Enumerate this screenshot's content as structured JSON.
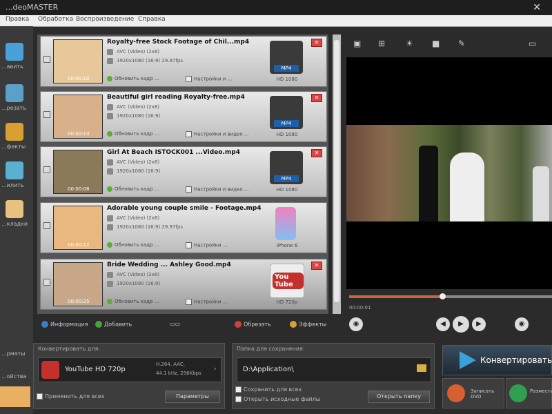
{
  "app": {
    "title": "...deoMASTER"
  },
  "menu": [
    "Правка",
    "Обработка",
    "Воспроизведение",
    "Справка"
  ],
  "sidebar": {
    "items": [
      {
        "label": "...авить",
        "icon": "add-video-icon",
        "color": "#4aa0d8"
      },
      {
        "label": "...резать",
        "icon": "cut-icon",
        "color": "#5aa0c8"
      },
      {
        "label": "...фекты",
        "icon": "effects-icon",
        "color": "#d8a030"
      },
      {
        "label": "...илить",
        "icon": "enhance-icon",
        "color": "#5ab0d0"
      },
      {
        "label": "...кладки",
        "icon": "tab-icon",
        "color": "#e8c080"
      }
    ],
    "bottom": [
      "...рматы",
      "...ойства"
    ]
  },
  "files": [
    {
      "name": "Royalty-free Stock Footage of Chil...mp4",
      "info1": "AVC (Video) (2x8)",
      "info2": "1920x1080 (16:9) 29.97fps",
      "opt1": "Обновить кадр ...",
      "opt2": "Настройки и ...",
      "duration": "00:00:10",
      "format_badge": "MP4",
      "format_caption": "HD 1080",
      "thumb_color": "#e8c89a"
    },
    {
      "name": "Beautiful girl reading Royalty-free.mp4",
      "info1": "AVC (Video) (2x8)",
      "info2": "1920x1080 (16:9)",
      "opt1": "Обновить кадр ...",
      "opt2": "Настройки и видео ...",
      "duration": "00:00:13",
      "format_badge": "MP4",
      "format_caption": "HD 1080",
      "thumb_color": "#d8b08a"
    },
    {
      "name": "Girl At Beach ISTOCK001 ...Video.mp4",
      "info1": "AVC (Video) (2x8)",
      "info2": "1920x1080 (16:9)",
      "opt1": "Обновить кадр ...",
      "opt2": "Настройки и видео ...",
      "duration": "00:00:08",
      "format_badge": "MP4",
      "format_caption": "HD 1080",
      "thumb_color": "#8a7a5a"
    },
    {
      "name": "Adorable young couple smile - Footage.mp4",
      "info1": "AVC (Video) (2x8)",
      "info2": "1920x1080 (16:9) 29.97fps",
      "opt1": "Обновить кадр ...",
      "opt2": "Настройки ...",
      "duration": "00:00:12",
      "format_badge": "",
      "format_caption": "iPhone 6",
      "thumb_color": "#e8b880"
    },
    {
      "name": "Bride Wedding ... Ashley Good.mp4",
      "info1": "AVC (Video) (2x8)",
      "info2": "1920x1080 (16:9)",
      "opt1": "Обновить кадр ...",
      "opt2": "Настройки ...",
      "duration": "00:00:25",
      "format_badge": "You Tube",
      "format_caption": "HD 720p",
      "thumb_color": "#c8a888"
    }
  ],
  "list_tools": {
    "info": "Информация",
    "add": "Добавить",
    "crop": "Обрезать",
    "effects": "Эффекты"
  },
  "player": {
    "time": "00:00:01",
    "progress": 0.46
  },
  "convert_format": {
    "title": "Конвертировать для:",
    "format": "YouTube HD 720p",
    "details1": "H.264, AAC,",
    "details2": "44.1 kHz, 256Kbps",
    "checkbox": "Применить для всех",
    "params_button": "Параметры"
  },
  "save_to": {
    "title": "Папка для сохранения:",
    "path": "D:\\Application\\",
    "checkbox1": "Сохранить для всех",
    "checkbox2": "Открыть исходные файлы",
    "open_button": "Открыть папку"
  },
  "convert": {
    "label": "Конвертировать",
    "burn_label": "Записать DVD",
    "share_label": "Разместить"
  }
}
